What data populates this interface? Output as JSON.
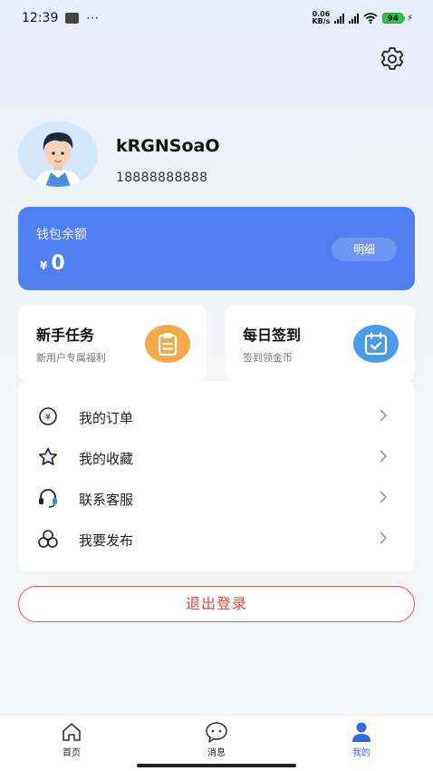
{
  "status_bar": {
    "time": "12:39",
    "dots": "···",
    "net_speed_value": "0.06",
    "net_speed_unit": "KB/s",
    "battery": "94"
  },
  "profile": {
    "username": "kRGNSoaO",
    "phone": "18888888888"
  },
  "wallet": {
    "label": "钱包余额",
    "currency": "¥",
    "amount": "0",
    "detail_label": "明细",
    "color": "#4f7ff0"
  },
  "cards": [
    {
      "title": "新手任务",
      "subtitle": "新用户专属福利",
      "icon": "clipboard-icon",
      "color": "#f4a94a"
    },
    {
      "title": "每日签到",
      "subtitle": "签到领金币",
      "icon": "calendar-check-icon",
      "color": "#4a9be8"
    }
  ],
  "menu": {
    "items": [
      {
        "label": "我的订单",
        "icon": "yuan-coin-icon"
      },
      {
        "label": "我的收藏",
        "icon": "star-icon"
      },
      {
        "label": "联系客服",
        "icon": "headset-icon"
      },
      {
        "label": "我要发布",
        "icon": "three-circles-icon"
      }
    ]
  },
  "logout": {
    "label": "退出登录",
    "color": "#e04a42"
  },
  "tabbar": {
    "items": [
      {
        "label": "首页",
        "icon": "home-icon",
        "active": false
      },
      {
        "label": "消息",
        "icon": "chat-bubble-icon",
        "active": false
      },
      {
        "label": "我的",
        "icon": "user-icon",
        "active": true
      }
    ],
    "active_color": "#3467e6"
  }
}
